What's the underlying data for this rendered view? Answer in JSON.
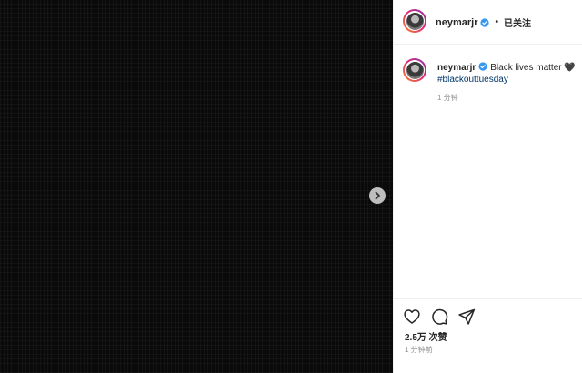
{
  "post": {
    "username": "neymarjr",
    "verified": true,
    "follow_status": "已关注",
    "separator": "•",
    "caption": {
      "username": "neymarjr",
      "text": "Black lives matter",
      "emoji": "🖤",
      "hashtag": "#blackouttuesday"
    },
    "caption_time": "1 分钟",
    "likes": "2.5万 次赞",
    "post_time": "1 分钟前"
  },
  "icons": {
    "next": "chevron-right-icon",
    "like": "heart-icon",
    "comment": "comment-icon",
    "share": "paper-plane-icon",
    "verified": "verified-badge-icon"
  },
  "colors": {
    "verified": "#3897f0",
    "link": "#00376b",
    "muted": "#8e8e8e",
    "media_bg": "#0a0a0a"
  }
}
